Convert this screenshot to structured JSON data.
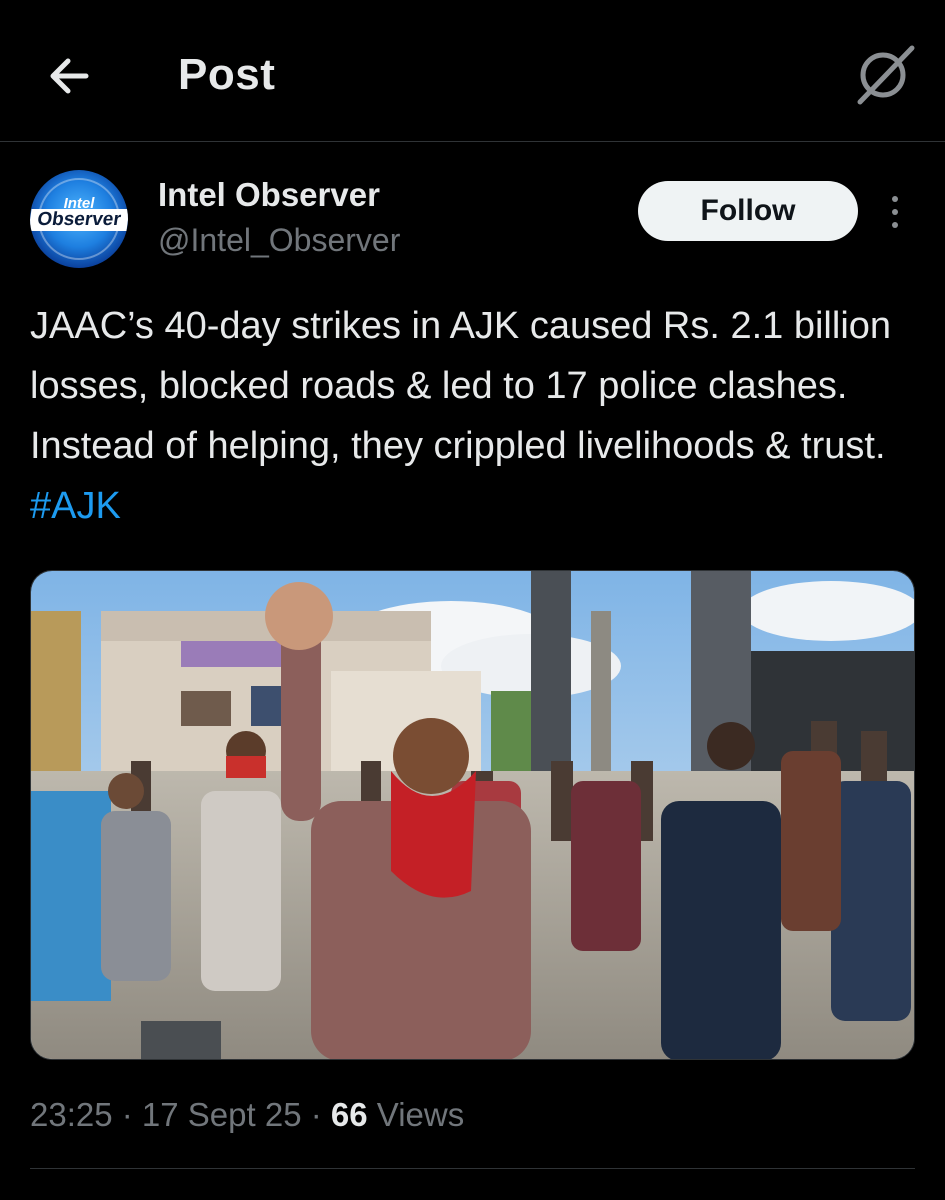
{
  "header": {
    "title": "Post",
    "back_icon": "arrow-left-icon",
    "grok_icon": "grok-icon"
  },
  "author": {
    "display_name": "Intel Observer",
    "handle": "@Intel_Observer",
    "avatar_line1": "Intel",
    "avatar_line2": "Observer"
  },
  "follow_label": "Follow",
  "more_icon": "more-vertical-icon",
  "post": {
    "text": "JAAC’s 40-day strikes in AJK caused Rs. 2.1 billion losses, blocked roads & led to 17 police clashes. Instead of helping, they crippled livelihoods & trust. ",
    "hashtag": "#AJK"
  },
  "media": {
    "description_icon": "photo-protest-crowd"
  },
  "meta": {
    "time": "23:25",
    "sep1": " · ",
    "date": "17 Sept 25",
    "sep2": " · ",
    "views_count": "66",
    "views_label": " Views"
  },
  "colors": {
    "background": "#000000",
    "text": "#e7e9ea",
    "muted": "#71767b",
    "link": "#1d9bf0",
    "border": "#2f3336"
  }
}
